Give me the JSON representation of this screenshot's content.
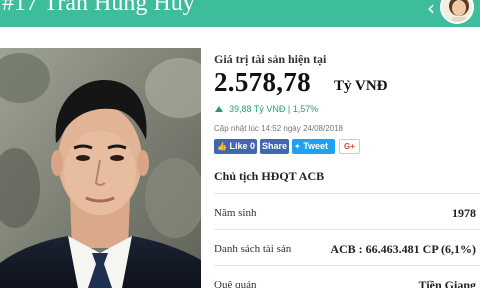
{
  "header": {
    "title": "#17 Trần Hùng Huy",
    "back_icon": "chevron-left-icon",
    "avatar_icon": "avatar-icon"
  },
  "profile": {
    "photo_icon": "portrait-photo",
    "net_worth_label": "Giá trị tài sản hiện tại",
    "net_worth_value": "2.578,78",
    "net_worth_unit": "Tỷ VNĐ",
    "change_text": "39,88 Tỷ VNĐ | 1,57%",
    "change_direction": "up",
    "updated_text": "Cập nhật lúc 14:52 ngày 24/08/2018",
    "position": "Chủ tịch HĐQT ACB"
  },
  "social": {
    "like_label": "Like 0",
    "share_label": "Share",
    "tweet_label": "Tweet",
    "gplus_label": "G+"
  },
  "details": [
    {
      "label": "Năm sinh",
      "value": "1978"
    },
    {
      "label": "Danh sách tài sản",
      "value": "ACB : 66.463.481 CP (6,1%)"
    },
    {
      "label": "Quê quán",
      "value": "Tiền Giang"
    }
  ],
  "colors": {
    "header_bg": "#3dbd9c",
    "change_up": "#2a9d6e",
    "facebook": "#4267b2",
    "twitter": "#1da1f2"
  }
}
